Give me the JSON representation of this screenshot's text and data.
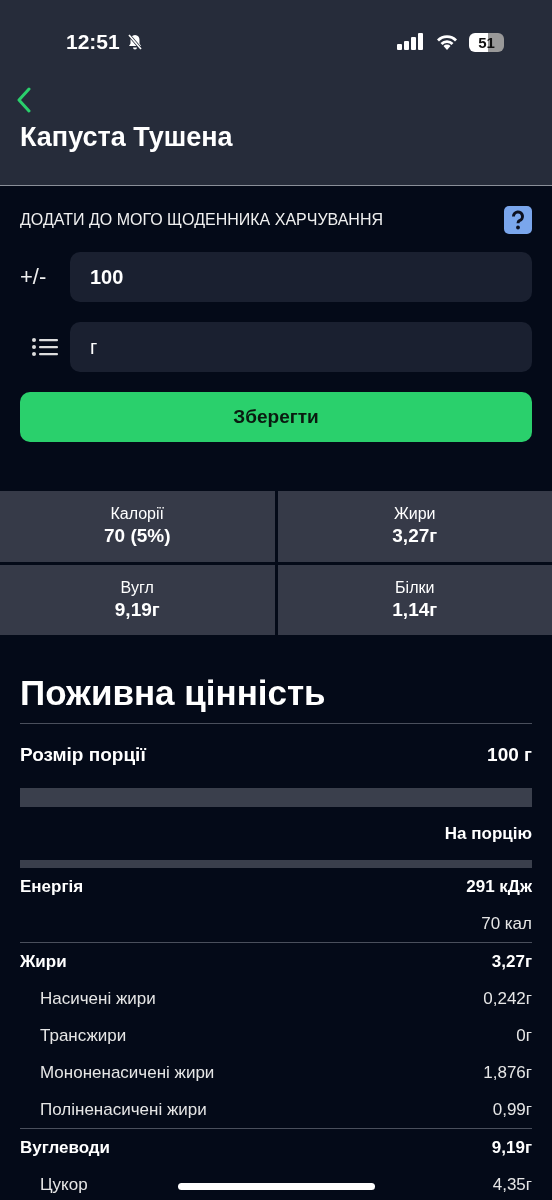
{
  "status_bar": {
    "time": "12:51",
    "battery": "51"
  },
  "header": {
    "title": "Капуста Тушена"
  },
  "diary": {
    "heading": "ДОДАТИ ДО МОГО ЩОДЕННИКА ХАРЧУВАННЯ",
    "amount_label": "+/-",
    "amount": "100",
    "unit": "г",
    "save": "Зберегти"
  },
  "summary": [
    {
      "label": "Калорії",
      "value": "70 (5%)"
    },
    {
      "label": "Жири",
      "value": "3,27г"
    },
    {
      "label": "Вугл",
      "value": "9,19г"
    },
    {
      "label": "Білки",
      "value": "1,14г"
    }
  ],
  "nutrition": {
    "title": "Поживна цінність",
    "serving_label": "Розмір порції",
    "serving_value": "100 г",
    "per_serving": "На порцію",
    "rows": [
      {
        "kind": "main",
        "label": "Енергія",
        "value": "291 кДж",
        "divider": false
      },
      {
        "kind": "extra",
        "value": "70 кал"
      },
      {
        "kind": "main",
        "label": "Жири",
        "value": "3,27г",
        "divider": true
      },
      {
        "kind": "sub",
        "label": "Насичені жири",
        "value": "0,242г"
      },
      {
        "kind": "sub",
        "label": "Трансжири",
        "value": "0г"
      },
      {
        "kind": "sub",
        "label": "Мононенасичені жири",
        "value": "1,876г"
      },
      {
        "kind": "sub",
        "label": "Поліненасичені жири",
        "value": "0,99г"
      },
      {
        "kind": "main",
        "label": "Вуглеводи",
        "value": "9,19г",
        "divider": true
      },
      {
        "kind": "sub",
        "label": "Цукор",
        "value": "4,35г"
      }
    ]
  }
}
